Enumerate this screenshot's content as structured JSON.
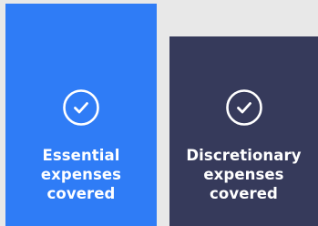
{
  "cards": [
    {
      "icon": "check-circle-icon",
      "label": "Essential\nexpenses\ncovered",
      "color": "#2f7cf6"
    },
    {
      "icon": "check-circle-icon",
      "label": "Discretionary\nexpenses\ncovered",
      "color": "#363a5b"
    }
  ]
}
